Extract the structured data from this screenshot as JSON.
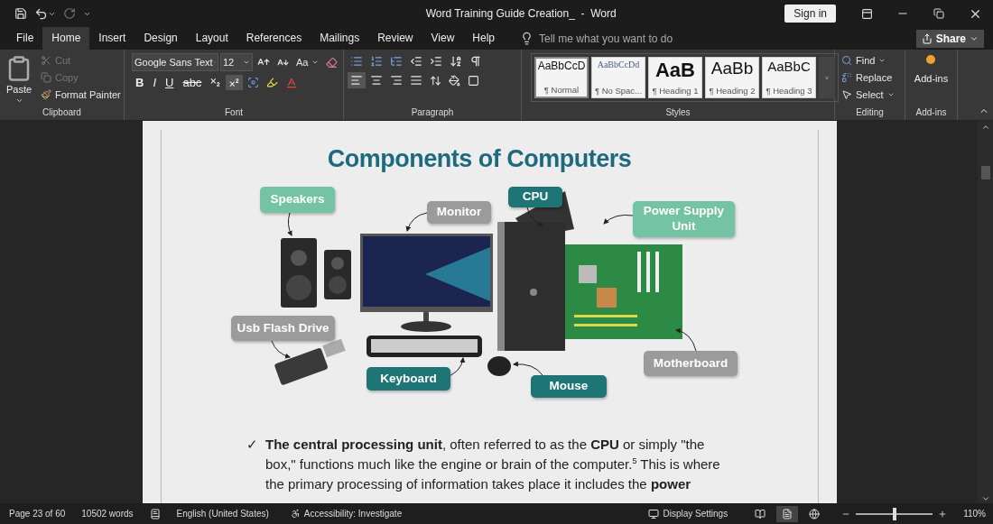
{
  "window": {
    "title": "Word Training Guide Creation_  -  Word",
    "sign_in": "Sign in"
  },
  "menu_tabs": [
    {
      "label": "File",
      "selected": false
    },
    {
      "label": "Home",
      "selected": true
    },
    {
      "label": "Insert",
      "selected": false
    },
    {
      "label": "Design",
      "selected": false
    },
    {
      "label": "Layout",
      "selected": false
    },
    {
      "label": "References",
      "selected": false
    },
    {
      "label": "Mailings",
      "selected": false
    },
    {
      "label": "Review",
      "selected": false
    },
    {
      "label": "View",
      "selected": false
    },
    {
      "label": "Help",
      "selected": false
    }
  ],
  "tell_me": {
    "placeholder": "Tell me what you want to do"
  },
  "share": "Share",
  "clipboard": {
    "label": "Clipboard",
    "paste": "Paste",
    "cut": {
      "label": "Cut",
      "disabled": true
    },
    "copy": {
      "label": "Copy",
      "disabled": true
    },
    "format_painter": "Format Painter"
  },
  "font": {
    "label": "Font",
    "name": "Google Sans Text",
    "size": "12",
    "change_case": "Aa",
    "styles": [
      {
        "label": "B",
        "kind": "bold"
      },
      {
        "label": "I",
        "kind": "italic"
      },
      {
        "label": "U",
        "kind": "underline"
      },
      {
        "label": "abc",
        "kind": "strike"
      }
    ],
    "scripts": [
      {
        "kind": "subscript",
        "selected": false
      },
      {
        "kind": "superscript",
        "selected": true
      }
    ]
  },
  "paragraph": {
    "label": "Paragraph",
    "alignment": [
      {
        "kind": "left",
        "selected": true
      },
      {
        "kind": "center",
        "selected": false
      },
      {
        "kind": "right",
        "selected": false
      },
      {
        "kind": "justify",
        "selected": false
      }
    ]
  },
  "styles": {
    "label": "Styles",
    "items": [
      {
        "sample": "AaBbCcD",
        "name": "¶ Normal",
        "kind": "normal",
        "selected": true
      },
      {
        "sample": "AaBbCcDd",
        "name": "¶ No Spac...",
        "kind": "nospace",
        "selected": false
      },
      {
        "sample": "AaB",
        "name": "¶ Heading 1",
        "kind": "h1",
        "selected": false
      },
      {
        "sample": "AaBb",
        "name": "¶ Heading 2",
        "kind": "h2",
        "selected": false
      },
      {
        "sample": "AaBbC",
        "name": "¶ Heading 3",
        "kind": "h3",
        "selected": false
      }
    ]
  },
  "editing": {
    "label": "Editing",
    "find": "Find",
    "replace": "Replace",
    "select": "Select"
  },
  "addins": {
    "label": "Add-ins",
    "button": "Add-ins"
  },
  "document": {
    "figure": {
      "title": "Components of Computers",
      "labels": [
        {
          "text": "Speakers",
          "color": "#74c3a4",
          "kind": "speakers"
        },
        {
          "text": "Monitor",
          "color": "#9b9b9b",
          "kind": "monitor"
        },
        {
          "text": "CPU",
          "color": "#1f7575",
          "kind": "cpu"
        },
        {
          "text": "Power Supply Unit",
          "color": "#74c3a4",
          "kind": "psu"
        },
        {
          "text": "Usb Flash Drive",
          "color": "#9b9b9b",
          "kind": "usb"
        },
        {
          "text": "Keyboard",
          "color": "#1f7575",
          "kind": "keyboard"
        },
        {
          "text": "Mouse",
          "color": "#1f7575",
          "kind": "mouse"
        },
        {
          "text": "Motherboard",
          "color": "#9b9b9b",
          "kind": "motherboard"
        }
      ]
    },
    "bullet": "✓",
    "paragraph": "**The central processing unit**, often referred to as the **CPU** or simply \"the box,\" functions much like the engine or brain of the computer.$^{5}$ This is where the primary processing of information takes place it includes the **power**"
  },
  "status": {
    "page": "Page 23 of 60",
    "words": "10502 words",
    "language": "English (United States)",
    "accessibility": "Accessibility: Investigate",
    "display": "Display Settings",
    "views": [
      {
        "kind": "read",
        "selected": false
      },
      {
        "kind": "print",
        "selected": true
      },
      {
        "kind": "web",
        "selected": false
      }
    ],
    "zoom": {
      "level": 0.5,
      "reading": "110%"
    }
  }
}
